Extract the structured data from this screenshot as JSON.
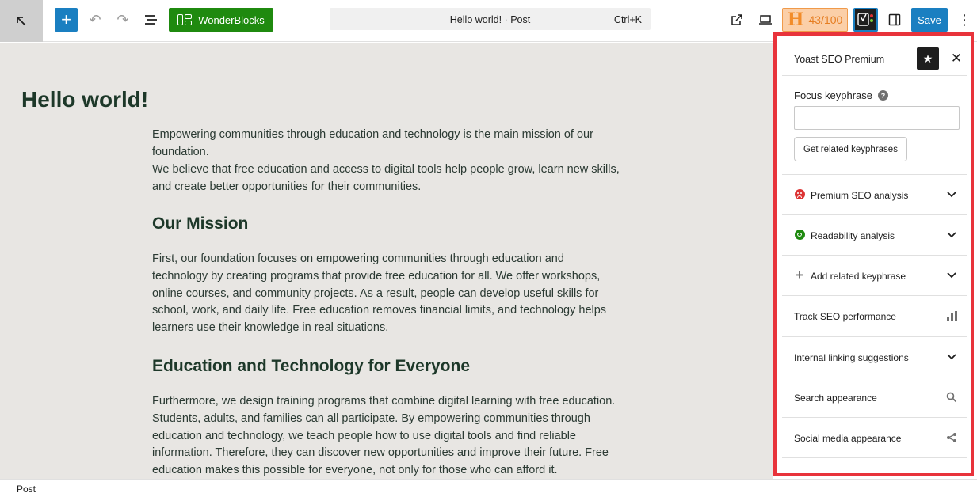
{
  "toolbar": {
    "logo_icon": "arrow-up-left-icon",
    "add_icon": "+",
    "undo_icon": "↶",
    "redo_icon": "↷",
    "wonderblocks_label": "WonderBlocks",
    "document_title": "Hello world! · Post",
    "shortcut": "Ctrl+K",
    "headline_letter": "H",
    "headline_score": "43/100",
    "save_label": "Save",
    "more_icon": "⋮"
  },
  "post": {
    "title": "Hello world!",
    "paragraph1": "Empowering communities through education and technology is the main mission of our foundation.",
    "paragraph2": "We believe that free education and access to digital tools help people grow, learn new skills, and create better opportunities for their communities.",
    "heading1": "Our Mission",
    "paragraph3": "First, our foundation focuses on empowering communities through education and technology by creating programs that provide free education for all. We offer workshops, online courses, and community projects. As a result, people can develop useful skills for school, work, and daily life. Free education removes financial limits, and technology helps learners use their knowledge in real situations.",
    "heading2": "Education and Technology for Everyone",
    "paragraph4": "Furthermore, we design training programs that combine digital learning with free education. Students, adults, and families can all participate. By empowering communities through education and technology, we teach people how to use digital tools and find reliable information. Therefore, they can discover new opportunities and improve their future. Free education makes this possible for everyone, not only for those who can afford it."
  },
  "footer": {
    "breadcrumb": "Post"
  },
  "sidebar": {
    "title": "Yoast SEO Premium",
    "star_icon": "★",
    "close_icon": "✕",
    "focus_keyphrase_label": "Focus keyphrase",
    "help_icon": "?",
    "focus_keyphrase_value": "",
    "related_button": "Get related keyphrases",
    "rows": [
      {
        "label": "Premium SEO analysis",
        "lead": "sad-face-icon",
        "trail": "chevron-down-icon"
      },
      {
        "label": "Readability analysis",
        "lead": "happy-face-icon",
        "trail": "chevron-down-icon"
      },
      {
        "label": "Add related keyphrase",
        "lead": "plus-icon",
        "trail": "chevron-down-icon"
      },
      {
        "label": "Track SEO performance",
        "trail": "bar-chart-icon"
      },
      {
        "label": "Internal linking suggestions",
        "trail": "chevron-down-icon"
      },
      {
        "label": "Search appearance",
        "trail": "search-icon"
      },
      {
        "label": "Social media appearance",
        "trail": "share-icon"
      }
    ]
  },
  "colors": {
    "primary": "#1a7fc1",
    "wonderblocks": "#1f8a0f",
    "highlight_border": "#e8333b",
    "headline_score": "#e67e22",
    "editor_bg": "#e8e6e3"
  }
}
